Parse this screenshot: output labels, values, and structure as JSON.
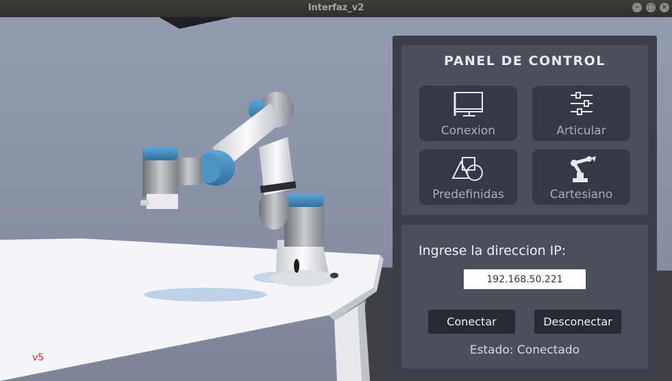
{
  "window": {
    "title": "Interfaz_v2"
  },
  "scene": {
    "version_label": "v5"
  },
  "panel": {
    "title": "PANEL DE CONTROL",
    "tiles": [
      {
        "label": "Conexion",
        "icon": "monitor-icon"
      },
      {
        "label": "Articular",
        "icon": "sliders-icon"
      },
      {
        "label": "Predefinidas",
        "icon": "shapes-icon"
      },
      {
        "label": "Cartesiano",
        "icon": "robot-arm-icon"
      }
    ],
    "connection": {
      "ip_label": "Ingrese la direccion IP:",
      "ip_value": "192.168.50.221",
      "connect_label": "Conectar",
      "disconnect_label": "Desconectar",
      "status_text": "Estado: Conectado"
    }
  }
}
